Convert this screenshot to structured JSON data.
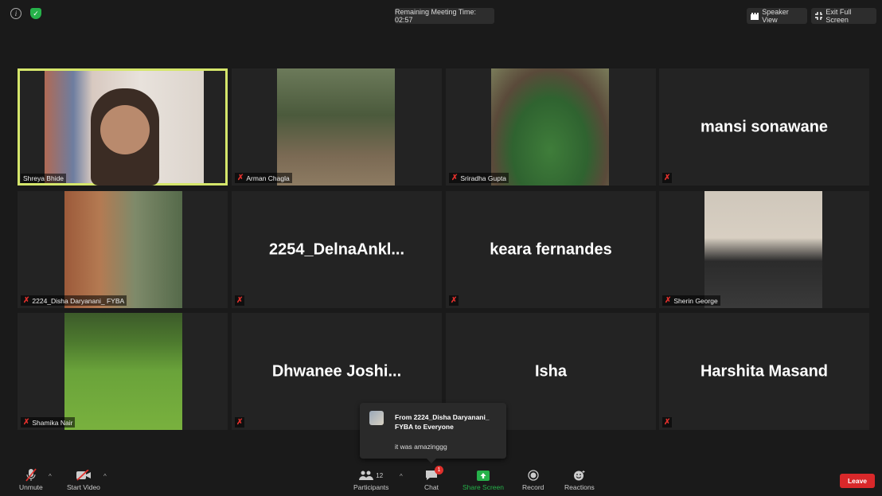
{
  "topbar": {
    "timer": "Remaining Meeting Time: 02:57",
    "speaker_view": "Speaker View",
    "exit_full_screen": "Exit Full Screen"
  },
  "tiles": {
    "shreya": "Shreya Bhide",
    "arman": "Arman Chagla",
    "sriradha": "Sriradha Gupta",
    "mansi": "mansi sonawane",
    "disha": "2224_Disha Daryanani_ FYBA",
    "delna": "2254_DelnaAnkl...",
    "keara": "keara fernandes",
    "sherin": "Sherin George",
    "shamika": "Shamika Nair",
    "dhwanee": "Dhwanee  Joshi...",
    "isha": "Isha",
    "harshita": "Harshita Masand"
  },
  "chat_popup": {
    "from": "From 2224_Disha Daryanani_ FYBA to Everyone",
    "message": "it was amazinggg"
  },
  "toolbar": {
    "unmute": "Unmute",
    "start_video": "Start Video",
    "participants": "Participants",
    "participant_count": "12",
    "chat": "Chat",
    "chat_badge": "1",
    "share_screen": "Share Screen",
    "record": "Record",
    "reactions": "Reactions",
    "leave": "Leave"
  },
  "colors": {
    "active_border": "#d5e66b",
    "leave": "#d9282a",
    "share_green": "#26b24a",
    "mic_muted": "#e0302c"
  }
}
